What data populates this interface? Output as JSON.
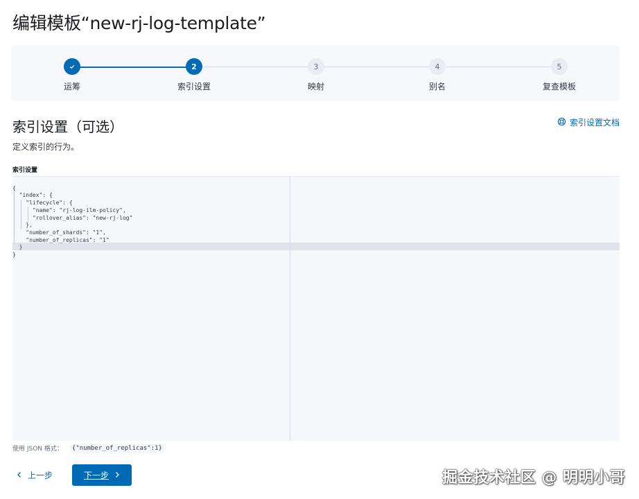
{
  "page": {
    "title": "编辑模板“new-rj-log-template”"
  },
  "steps": [
    {
      "number": "",
      "label": "运筹",
      "state": "done"
    },
    {
      "number": "2",
      "label": "索引设置",
      "state": "current"
    },
    {
      "number": "3",
      "label": "映射",
      "state": "todo"
    },
    {
      "number": "4",
      "label": "别名",
      "state": "todo"
    },
    {
      "number": "5",
      "label": "复查模板",
      "state": "todo"
    }
  ],
  "section": {
    "title": "索引设置（可选）",
    "description": "定义索引的行为。",
    "doc_link": "索引设置文档",
    "field_label": "索引设置"
  },
  "editor": {
    "lines": [
      "{",
      "  \"index\": {",
      "    \"lifecycle\": {",
      "      \"name\": \"rj-log-ilm-policy\",",
      "      \"rollover_alias\": \"new-rj-log\"",
      "    },",
      "    \"number_of_shards\": \"1\",",
      "    \"number_of_replicas\": \"1\"",
      "  }",
      "}"
    ]
  },
  "hint": {
    "label": "使用 JSON 格式：",
    "example": "{\"number_of_replicas\":1}"
  },
  "buttons": {
    "back": "上一步",
    "next": "下一步"
  },
  "watermark": "掘金技术社区 @ 明明小哥",
  "colors": {
    "primary": "#006bb4",
    "inactive": "#e9ecf2"
  }
}
